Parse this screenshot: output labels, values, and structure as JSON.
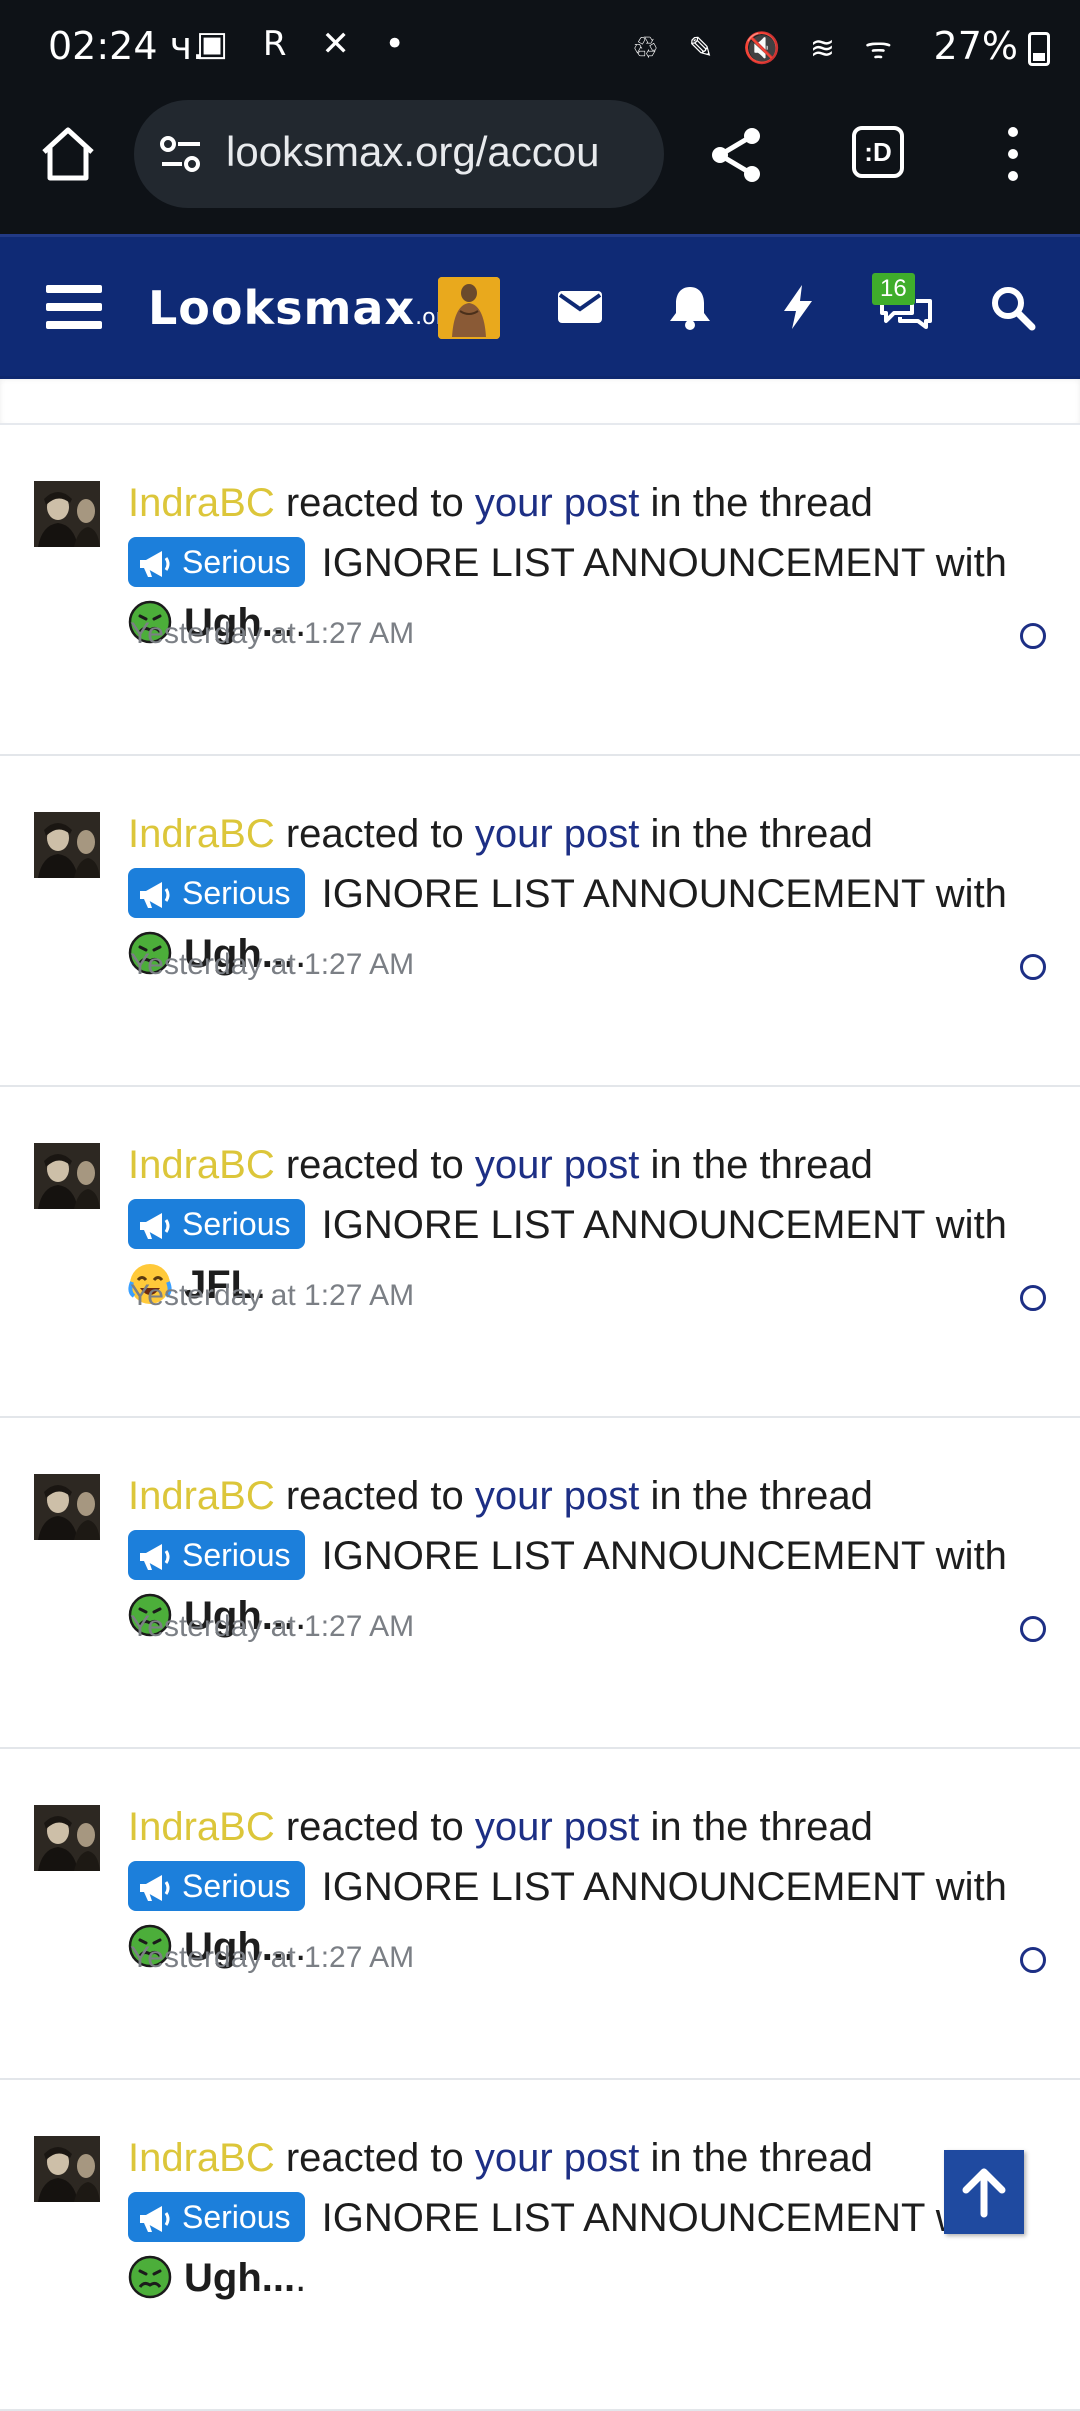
{
  "status_bar": {
    "time": "02:24",
    "time_suffix": "ч.",
    "left_icons": "▣ R ✕ •",
    "right_icons": "♲ ✎ 🔇 ≋ ᯤ",
    "battery": "27%"
  },
  "browser": {
    "url": "looksmax.org/accou",
    "tabs_label": ":D"
  },
  "site": {
    "logo_main": "Looksmax",
    "logo_org": ".org",
    "chat_badge": "16"
  },
  "notifications": [
    {
      "user": "IndraBC",
      "t1": " reacted to ",
      "link": "your post",
      "t2": " in the thread ",
      "prefix": "Serious",
      "thread": " IGNORE LIST ANNOUNCEMENT with ",
      "reaction": "Ugh...",
      "reaction_kind": "ugh",
      "time": "Yesterday at 1:27 AM"
    },
    {
      "user": "IndraBC",
      "t1": " reacted to ",
      "link": "your post",
      "t2": " in the thread ",
      "prefix": "Serious",
      "thread": " IGNORE LIST ANNOUNCEMENT with ",
      "reaction": "Ugh...",
      "reaction_kind": "ugh",
      "time": "Yesterday at 1:27 AM"
    },
    {
      "user": "IndraBC",
      "t1": " reacted to ",
      "link": "your post",
      "t2": " in the thread ",
      "prefix": "Serious",
      "thread": " IGNORE LIST ANNOUNCEMENT with ",
      "reaction": "JFL",
      "reaction_kind": "jfl",
      "time": "Yesterday at 1:27 AM"
    },
    {
      "user": "IndraBC",
      "t1": " reacted to ",
      "link": "your post",
      "t2": " in the thread ",
      "prefix": "Serious",
      "thread": " IGNORE LIST ANNOUNCEMENT with ",
      "reaction": "Ugh...",
      "reaction_kind": "ugh",
      "time": "Yesterday at 1:27 AM"
    },
    {
      "user": "IndraBC",
      "t1": " reacted to ",
      "link": "your post",
      "t2": " in the thread ",
      "prefix": "Serious",
      "thread": " IGNORE LIST ANNOUNCEMENT with ",
      "reaction": "Ugh...",
      "reaction_kind": "ugh",
      "time": "Yesterday at 1:27 AM"
    },
    {
      "user": "IndraBC",
      "t1": " reacted to ",
      "link": "your post",
      "t2": " in the thread ",
      "prefix": "Serious",
      "thread": " IGNORE LIST ANNOUNCEMENT with ",
      "reaction": "Ugh...",
      "reaction_kind": "ugh",
      "time": ""
    }
  ],
  "colors": {
    "header_bg": "#0f2a75",
    "username": "#dcc63a",
    "link": "#1d2f85",
    "prefix_bg": "#1c7fdb",
    "badge_bg": "#3fad2b"
  }
}
